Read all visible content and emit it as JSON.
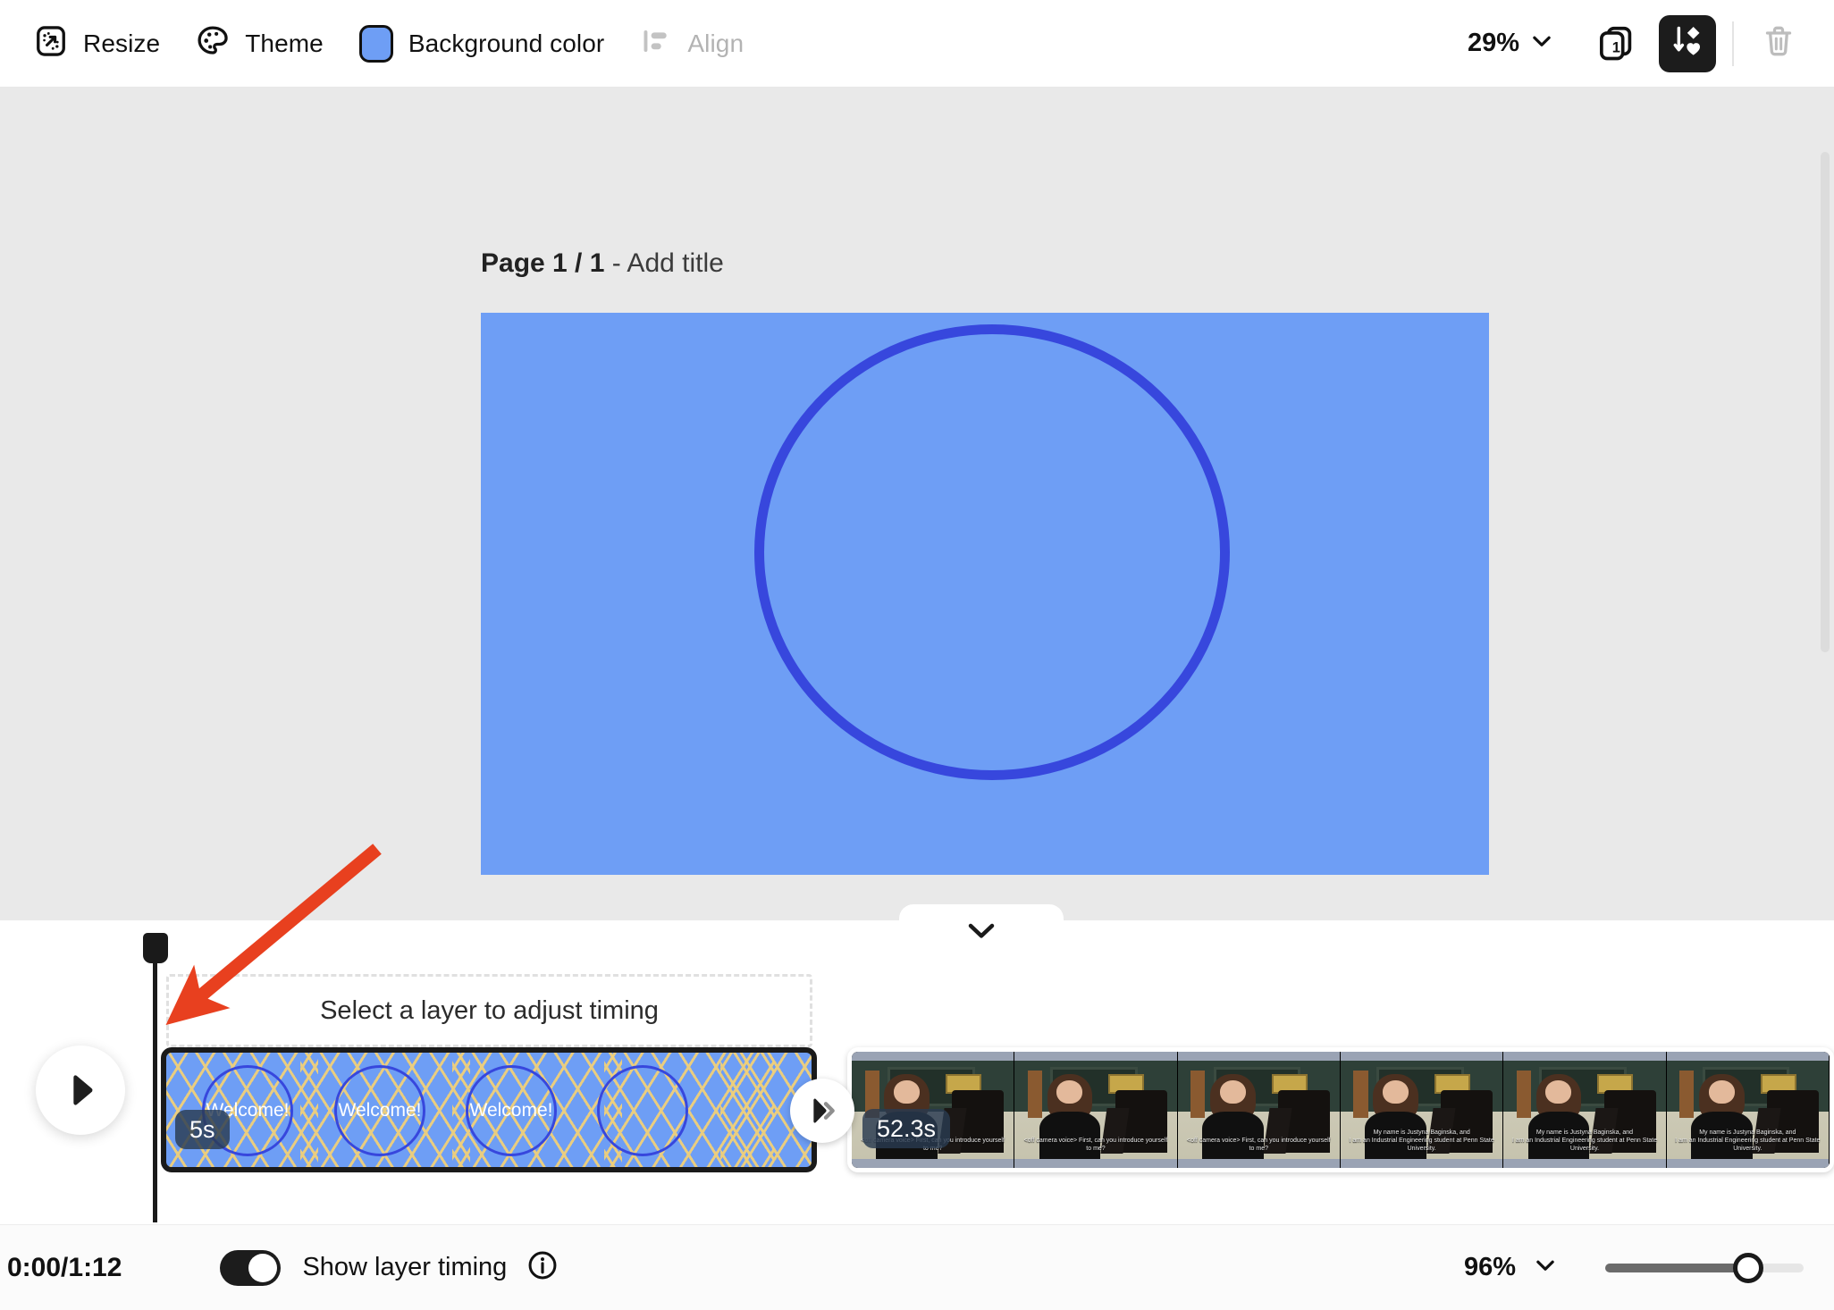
{
  "toolbar": {
    "resize_label": "Resize",
    "theme_label": "Theme",
    "background_color_label": "Background color",
    "align_label": "Align",
    "zoom_value": "29%",
    "pages_count": "1",
    "background_color_hex": "#6e9ef5"
  },
  "canvas": {
    "page_title_bold": "Page 1 / 1",
    "page_title_rest": "- Add title",
    "artboard_background_hex": "#6e9ef5",
    "shape_stroke_hex": "#3747dd"
  },
  "timeline": {
    "layer_slot_text": "Select a layer to adjust timing",
    "clips": [
      {
        "name": "shape-clip",
        "duration_badge": "5s",
        "circle_labels": [
          "Welcome!",
          "Welcome!",
          "Welcome!",
          ""
        ]
      },
      {
        "name": "video-clip",
        "duration_badge": "52.3s",
        "subtitle_early": "<off camera voice> First, can you introduce yourself to me?",
        "subtitle_late_line1": "My name is Justyna Baginska, and",
        "subtitle_late_line2": "I am an Industrial Engineering student at Penn State University."
      }
    ]
  },
  "bottombar": {
    "timecode": "0:00/1:12",
    "show_layer_timing_label": "Show layer timing",
    "toggle_state": "on",
    "zoom_value": "96%",
    "slider_percent": 72
  },
  "annotation": {
    "arrow_color": "#e8401f"
  }
}
